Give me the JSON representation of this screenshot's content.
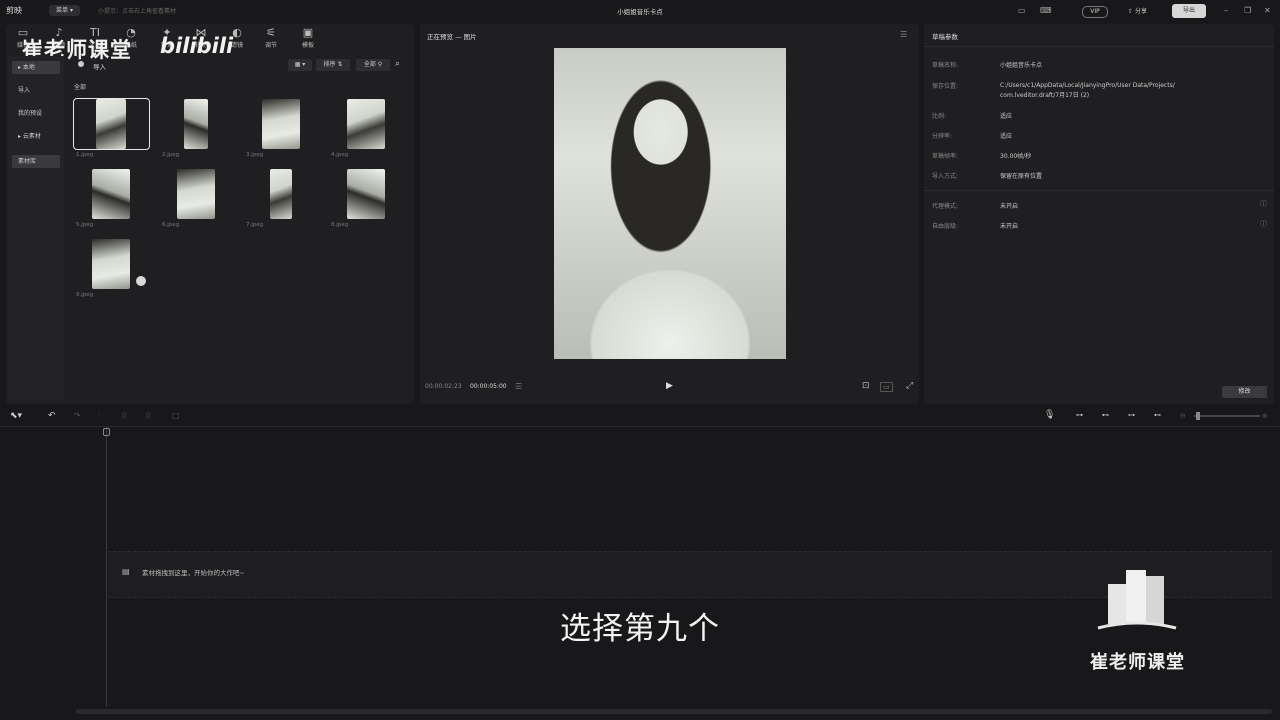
{
  "titlebar": {
    "app_name": "剪映",
    "menu_label": "菜单",
    "tip": "小提示：点击右上角查看素材",
    "doc_title": "小姐姐音乐卡点",
    "vip": "VIP",
    "share": "分享",
    "export": "导出"
  },
  "toolbar": {
    "tabs": [
      {
        "label": "媒体",
        "icon": "▭"
      },
      {
        "label": "音频",
        "icon": "♪"
      },
      {
        "label": "文本",
        "icon": "TI"
      },
      {
        "label": "贴纸",
        "icon": "◔"
      },
      {
        "label": "特效",
        "icon": "✦"
      },
      {
        "label": "转场",
        "icon": "⋈"
      },
      {
        "label": "滤镜",
        "icon": "◐"
      },
      {
        "label": "调节",
        "icon": "⚟"
      },
      {
        "label": "模板",
        "icon": "▣"
      }
    ]
  },
  "watermark": {
    "top_left": "崔老师课堂",
    "bili": "bilibili",
    "bottom_right": "崔老师课堂"
  },
  "left_rail": {
    "items": [
      "本地",
      "导入",
      "我的预设",
      "云素材",
      "素材库"
    ]
  },
  "media": {
    "import_label": "导入",
    "filter_all": "全部",
    "sort_label": "排序",
    "all_label": "全部",
    "files": [
      "1.jpeg",
      "2.jpeg",
      "3.jpeg",
      "4.jpeg",
      "5.jpeg",
      "6.jpeg",
      "7.jpeg",
      "8.jpeg",
      "9.jpeg"
    ]
  },
  "preview": {
    "title": "正在预览 — 图片",
    "time_current": "00:00:02:23",
    "time_total": "00:00:05:00"
  },
  "props": {
    "title": "草稿参数",
    "rows": [
      {
        "label": "草稿名称:",
        "value": "小姐姐音乐卡点"
      },
      {
        "label": "保存位置:",
        "value": "C:/Users/c1/AppData/Local/JianyingPro/User Data/Projects/ com.lveditor.draft/7月17日 (2)"
      },
      {
        "label": "比例:",
        "value": "适应"
      },
      {
        "label": "分辨率:",
        "value": "适应"
      },
      {
        "label": "草稿帧率:",
        "value": "30.00帧/秒"
      },
      {
        "label": "导入方式:",
        "value": "保留在原有位置"
      },
      {
        "label": "代理模式:",
        "value": "未开启"
      },
      {
        "label": "自由层级:",
        "value": "未开启"
      }
    ],
    "modify_button": "修改"
  },
  "timeline": {
    "hint": "素材拖拽到这里，开始你的大作吧~",
    "subtitle": "选择第九个"
  }
}
